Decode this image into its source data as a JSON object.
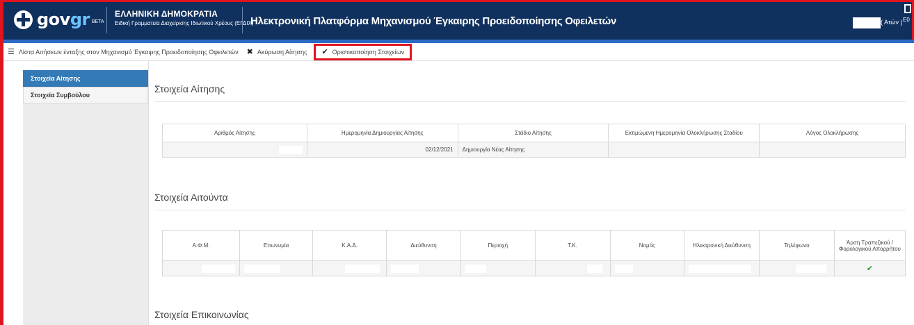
{
  "header": {
    "logo_text_gov": "gov",
    "logo_text_gr": "gr",
    "logo_beta": "BETA",
    "gov_title": "ΕΛΛΗΝΙΚΗ ΔΗΜΟΚΡΑΤΙΑ",
    "gov_subtitle": "Ειδική Γραμματεία Διαχείρισης Ιδιωτικού Χρέους (ΕΓΔΙΧ)",
    "app_title": "Ηλεκτρονική Πλατφόρμα Μηχανισμού Έγκαιρης Προειδοποίησης Οφειλετών",
    "user_label": "( Ατών )",
    "exit_label": "Ε0"
  },
  "toolbar": {
    "list_label": "Λίστα Αιτήσεων ένταξης στον Μηχανισμό Έγκαιρης Προειδοποίησης Οφειλετών",
    "cancel_label": "Ακύρωση Αίτησης",
    "finalize_label": "Οριστικοποίηση Στοιχείων"
  },
  "sidebar": {
    "items": [
      {
        "label": "Στοιχεία Αίτησης",
        "active": true
      },
      {
        "label": "Στοιχεία Συμβούλου",
        "active": false
      }
    ]
  },
  "sections": {
    "application": {
      "title": "Στοιχεία Αίτησης",
      "headers": [
        "Αριθμός Αίτησης",
        "Ημερομηνία Δημιουργίας Αίτησης",
        "Στάδιο Αίτησης",
        "Εκτιμώμενη Ημερομηνία Ολοκλήρωσης Σταδίου",
        "Λόγος Ολοκλήρωσης"
      ],
      "row": {
        "number": "",
        "created": "02/12/2021",
        "stage": "Δημιουργία Νέας Αίτησης",
        "estimated": "",
        "reason": ""
      }
    },
    "applicant": {
      "title": "Στοιχεία Αιτούντα",
      "headers": [
        "Α.Φ.Μ.",
        "Επωνυμία",
        "Κ.Α.Δ.",
        "Διεύθυνση",
        "Περιοχή",
        "Τ.Κ.",
        "Νομός",
        "Ηλεκτρονική Διεύθυνση",
        "Τηλέφωνο",
        "Άρση Τραπεζικού / Φορολογικού Απορρήτου"
      ],
      "row_check": "✔"
    },
    "contact": {
      "title": "Στοιχεία Επικοινωνίας"
    }
  },
  "colors": {
    "header": "#10305e",
    "accent": "#2c6bc5",
    "highlight": "#e0141e",
    "active": "#337ab7",
    "check": "#2e9e2e"
  }
}
